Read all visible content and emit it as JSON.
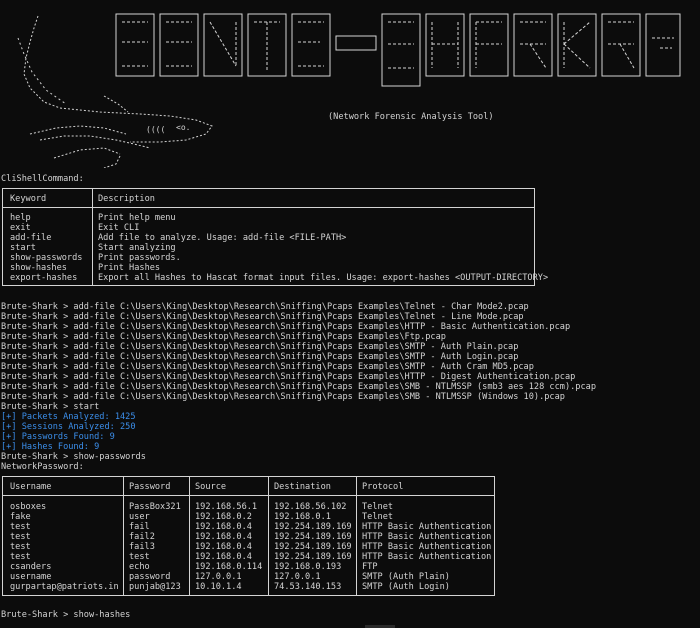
{
  "banner": {
    "logo_text": "BRUTE-SHARK",
    "subtitle": "(Network Forensic Analysis Tool)"
  },
  "cli_header": "CliShellCommand:",
  "commands_table": {
    "headers": [
      "Keyword",
      "Description"
    ],
    "rows": [
      [
        "help",
        "Print help menu"
      ],
      [
        "exit",
        "Exit CLI"
      ],
      [
        "add-file",
        "Add file to analyze. Usage: add-file <FILE-PATH>"
      ],
      [
        "start",
        "Start analyzing"
      ],
      [
        "show-passwords",
        "Print passwords."
      ],
      [
        "show-hashes",
        "Print Hashes"
      ],
      [
        "export-hashes",
        "Export all Hashes to Hascat format input files. Usage: export-hashes <OUTPUT-DIRECTORY>"
      ]
    ]
  },
  "session_lines": [
    "Brute-Shark > add-file C:\\Users\\King\\Desktop\\Research\\Sniffing\\Pcaps Examples\\Telnet - Char Mode2.pcap",
    "Brute-Shark > add-file C:\\Users\\King\\Desktop\\Research\\Sniffing\\Pcaps Examples\\Telnet - Line Mode.pcap",
    "Brute-Shark > add-file C:\\Users\\King\\Desktop\\Research\\Sniffing\\Pcaps Examples\\HTTP - Basic Authentication.pcap",
    "Brute-Shark > add-file C:\\Users\\King\\Desktop\\Research\\Sniffing\\Pcaps Examples\\Ftp.pcap",
    "Brute-Shark > add-file C:\\Users\\King\\Desktop\\Research\\Sniffing\\Pcaps Examples\\SMTP - Auth Plain.pcap",
    "Brute-Shark > add-file C:\\Users\\King\\Desktop\\Research\\Sniffing\\Pcaps Examples\\SMTP - Auth Login.pcap",
    "Brute-Shark > add-file C:\\Users\\King\\Desktop\\Research\\Sniffing\\Pcaps Examples\\SMTP - Auth Cram MD5.pcap",
    "Brute-Shark > add-file C:\\Users\\King\\Desktop\\Research\\Sniffing\\Pcaps Examples\\HTTP - Digest Authentication.pcap",
    "Brute-Shark > add-file C:\\Users\\King\\Desktop\\Research\\Sniffing\\Pcaps Examples\\SMB - NTLMSSP (smb3 aes 128 ccm).pcap",
    "Brute-Shark > add-file C:\\Users\\King\\Desktop\\Research\\Sniffing\\Pcaps Examples\\SMB - NTLMSSP (Windows 10).pcap",
    "Brute-Shark > start"
  ],
  "status_lines": [
    "[+] Packets Analyzed: 1425",
    "[+] Sessions Analyzed: 250",
    "[+] Passwords Found: 9",
    "[+] Hashes Found: 9"
  ],
  "show_passwords_cmd": "Brute-Shark > show-passwords",
  "network_password_header": "NetworkPassword:",
  "passwords_table": {
    "headers": [
      "Username",
      "Password",
      "Source",
      "Destination",
      "Protocol"
    ],
    "rows": [
      [
        "osboxes",
        "PassBox321",
        "192.168.56.1",
        "192.168.56.102",
        "Telnet"
      ],
      [
        "fake",
        "user",
        "192.168.0.2",
        "192.168.0.1",
        "Telnet"
      ],
      [
        "test",
        "fail",
        "192.168.0.4",
        "192.254.189.169",
        "HTTP Basic Authentication"
      ],
      [
        "test",
        "fail2",
        "192.168.0.4",
        "192.254.189.169",
        "HTTP Basic Authentication"
      ],
      [
        "test",
        "fail3",
        "192.168.0.4",
        "192.254.189.169",
        "HTTP Basic Authentication"
      ],
      [
        "test",
        "test",
        "192.168.0.4",
        "192.254.189.169",
        "HTTP Basic Authentication"
      ],
      [
        "csanders",
        "echo",
        "192.168.0.114",
        "192.168.0.193",
        "FTP"
      ],
      [
        "username",
        "password",
        "127.0.0.1",
        "127.0.0.1",
        "SMTP (Auth Plain)"
      ],
      [
        "gurpartap@patriots.in",
        "punjab@123",
        "10.10.1.4",
        "74.53.140.153",
        "SMTP (Auth Login)"
      ]
    ]
  },
  "show_hashes_cmd": "Brute-Shark > show-hashes",
  "colors": {
    "background": "#0c0c0c",
    "text": "#d4d4d4",
    "info_blue": "#3b8eea"
  }
}
